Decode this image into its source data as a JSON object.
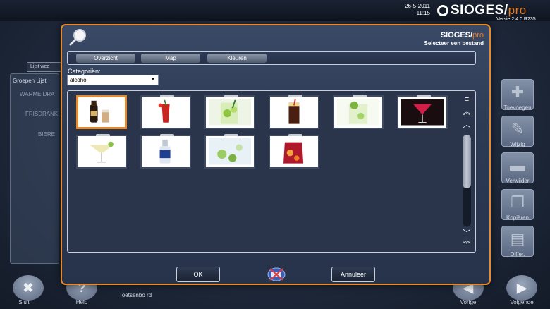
{
  "header": {
    "date": "26-5-2011",
    "time": "11:15",
    "logo": "SIOGES/",
    "logo_pro": "pro",
    "version": "Versie 2.4.0 R235"
  },
  "background": {
    "tab_label": "Lijst wee",
    "panel_heading": "Groepen Lijst",
    "rows": [
      "WARME DRA",
      "FRISDRANK",
      "BIERE"
    ]
  },
  "side_buttons": [
    "Toevoegen",
    "Wijzig",
    "Verwijder",
    "Kopiëren",
    "Differ."
  ],
  "bottom_buttons": {
    "close": "Sluit",
    "help": "Help",
    "keyboard": "Toetsenbo rd",
    "previous": "Vorige",
    "next": "Volgende"
  },
  "dialog": {
    "logo": "SIOGES/",
    "logo_pro": "pro",
    "subtitle": "Selecteer een bestand",
    "tabs": [
      "Overzicht",
      "Map",
      "Kleuren"
    ],
    "category_label": "Categoriën:",
    "category_value": "alcohol",
    "ok_label": "OK",
    "cancel_label": "Annuleer"
  },
  "thumbnails": [
    {
      "name": "cream-liqueur",
      "selected": true
    },
    {
      "name": "bloody-mary",
      "selected": false
    },
    {
      "name": "mojito",
      "selected": false
    },
    {
      "name": "cola-drink",
      "selected": false
    },
    {
      "name": "lime-cocktail",
      "selected": false
    },
    {
      "name": "red-martini",
      "selected": false
    },
    {
      "name": "margarita",
      "selected": false
    },
    {
      "name": "vodka-bottle",
      "selected": false
    },
    {
      "name": "caipirinha",
      "selected": false
    },
    {
      "name": "sangria",
      "selected": false
    }
  ],
  "colors": {
    "accent": "#e88a2a",
    "dialog_bg": "#2d3a54"
  }
}
